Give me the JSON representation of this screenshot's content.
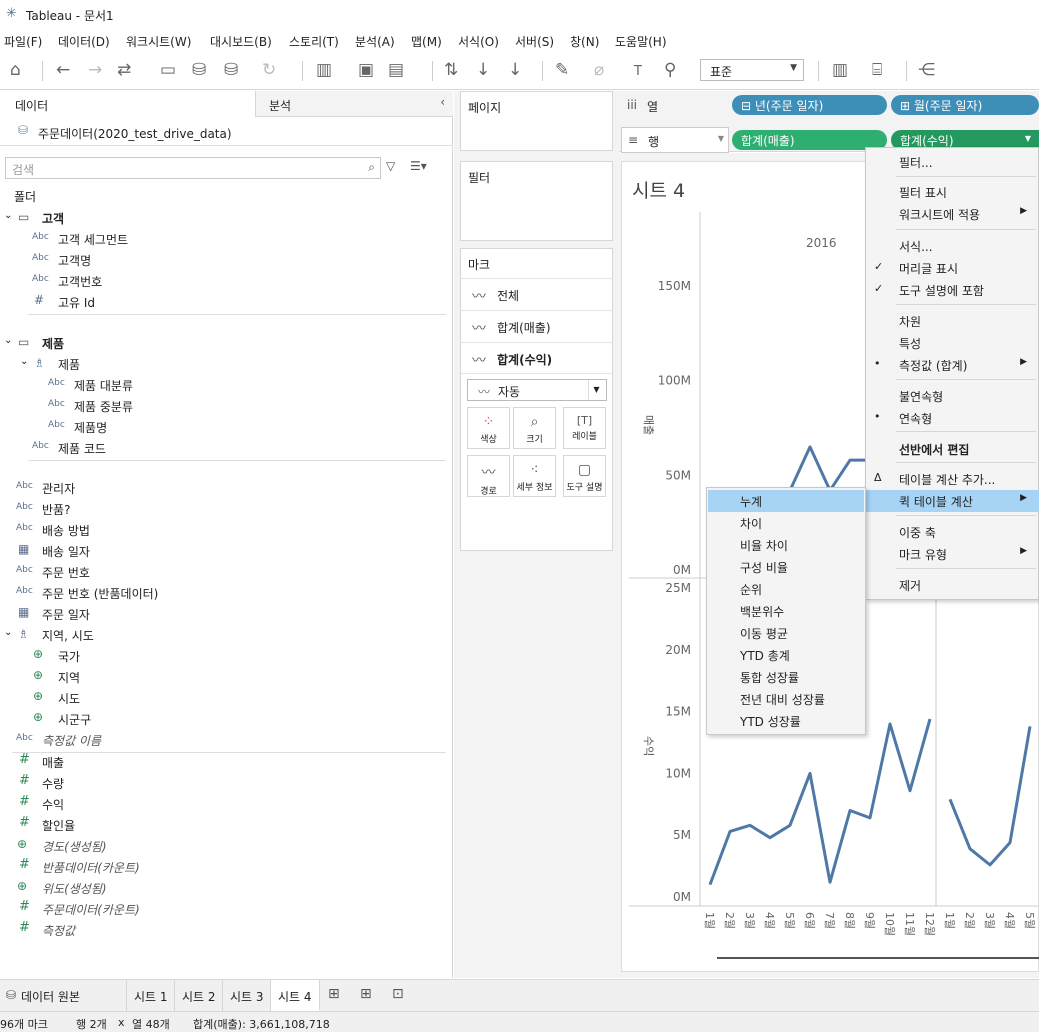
{
  "window": {
    "title": "Tableau - 문서1"
  },
  "menu": [
    "파일(F)",
    "데이터(D)",
    "워크시트(W)",
    "대시보드(B)",
    "스토리(T)",
    "분석(A)",
    "맵(M)",
    "서식(O)",
    "서버(S)",
    "창(N)",
    "도움말(H)"
  ],
  "toolbar": {
    "fit_select": "표준"
  },
  "data_pane": {
    "tab_data": "데이터",
    "tab_analysis": "분석",
    "datasource": "주문데이터(2020_test_drive_data)",
    "search_placeholder": "검색",
    "folder_label": "폴더",
    "groups": {
      "customer": {
        "name": "고객",
        "items": [
          "고객 세그먼트",
          "고객명",
          "고객번호",
          "고유 Id"
        ]
      },
      "product": {
        "name": "제품",
        "hierarchy": "제품",
        "items": [
          "제품 대분류",
          "제품 중분류",
          "제품명"
        ],
        "code": "제품 코드"
      }
    },
    "dimensions": [
      "관리자",
      "반품?",
      "배송 방법",
      "배송 일자",
      "주문 번호",
      "주문 번호 (반품데이터)",
      "주문 일자"
    ],
    "geo": {
      "name": "지역, 시도",
      "items": [
        "국가",
        "지역",
        "시도",
        "시군구"
      ]
    },
    "measure_names": "측정값 이름",
    "measures": [
      "매출",
      "수량",
      "수익",
      "할인율"
    ],
    "generated": [
      "경도(생성됨)",
      "반품데이터(카운트)",
      "위도(생성됨)",
      "주문데이터(카운트)",
      "측정값"
    ]
  },
  "cards": {
    "pages": "페이지",
    "filters": "필터",
    "marks": "마크",
    "marks_rows": [
      "전체",
      "합계(매출)",
      "합계(수익)"
    ],
    "mark_type": "자동",
    "mark_buttons": [
      "색상",
      "크기",
      "레이블",
      "경로",
      "세부 정보",
      "도구 설명"
    ]
  },
  "shelves": {
    "columns_label": "열",
    "rows_label": "행",
    "col_pills": [
      "년(주문 일자)",
      "월(주문 일자)"
    ],
    "row_pills": [
      "합계(매출)",
      "합계(수익)"
    ]
  },
  "sheet": {
    "title": "시트 4",
    "year": "2016",
    "top_axis": {
      "label": "매출",
      "ticks": [
        "150M",
        "100M",
        "50M",
        "0M"
      ]
    },
    "bottom_axis": {
      "label": "수익",
      "ticks": [
        "25M",
        "20M",
        "15M",
        "10M",
        "5M",
        "0M"
      ]
    },
    "month_labels_a": [
      "1월",
      "2월",
      "3월",
      "4월",
      "5월",
      "6월",
      "7월",
      "8월",
      "9월",
      "10월",
      "11월",
      "12월"
    ],
    "month_labels_b": [
      "1월",
      "2월",
      "3월",
      "4월",
      "5월"
    ]
  },
  "chart_data": {
    "type": "line",
    "title": "시트 4",
    "series": [
      {
        "name": "합계(매출)",
        "x": [
          "1월",
          "2월",
          "3월",
          "4월",
          "5월",
          "6월",
          "7월",
          "8월",
          "9월",
          "10월",
          "11월",
          "12월"
        ],
        "values": [
          null,
          null,
          null,
          null,
          42,
          65,
          42,
          58,
          58,
          null,
          null,
          null
        ],
        "ylim": [
          0,
          160
        ]
      },
      {
        "name": "합계(수익)",
        "x": [
          "1월",
          "2월",
          "3월",
          "4월",
          "5월",
          "6월",
          "7월",
          "8월",
          "9월",
          "10월",
          "11월",
          "12월"
        ],
        "values": [
          1.0,
          5.3,
          5.8,
          4.8,
          5.8,
          10.0,
          1.2,
          7.0,
          6.4,
          14.0,
          8.6,
          14.4
        ],
        "ylim": [
          0,
          25
        ]
      },
      {
        "name": "합계(수익)",
        "x": [
          "1월",
          "2월",
          "3월",
          "4월",
          "5월"
        ],
        "values": [
          7.9,
          3.9,
          2.6,
          4.4,
          13.8
        ],
        "ylim": [
          0,
          25
        ]
      }
    ],
    "ylabel": "수익"
  },
  "context_menu": [
    {
      "label": "필터...",
      "check": ""
    },
    {
      "label": "필터 표시",
      "check": ""
    },
    {
      "label": "워크시트에 적용",
      "check": "",
      "sub": true
    },
    {
      "label": "서식...",
      "check": ""
    },
    {
      "label": "머리글 표시",
      "check": "✓"
    },
    {
      "label": "도구 설명에 포함",
      "check": "✓"
    },
    {
      "label": "차원",
      "check": ""
    },
    {
      "label": "특성",
      "check": ""
    },
    {
      "label": "측정값 (합계)",
      "check": "•",
      "sub": true
    },
    {
      "label": "불연속형",
      "check": ""
    },
    {
      "label": "연속형",
      "check": "•"
    },
    {
      "label": "선반에서 편집",
      "check": ""
    },
    {
      "label": "테이블 계산 추가...",
      "check": "Δ"
    },
    {
      "label": "퀵 테이블 계산",
      "check": "",
      "sub": true
    },
    {
      "label": "이중 축",
      "check": ""
    },
    {
      "label": "마크 유형",
      "check": "",
      "sub": true
    },
    {
      "label": "제거",
      "check": ""
    }
  ],
  "submenu": [
    "누계",
    "차이",
    "비율 차이",
    "구성 비율",
    "순위",
    "백분위수",
    "이동 평균",
    "YTD 총계",
    "통합 성장률",
    "전년 대비 성장률",
    "YTD 성장률"
  ],
  "bottom_tabs": [
    "데이터 원본",
    "시트 1",
    "시트 2",
    "시트 3",
    "시트 4"
  ],
  "status": {
    "marks": "96개 마크",
    "rows": "행 2개",
    "x": "x",
    "cols": "열 48개",
    "sum": "합계(매출): 3,661,108,718"
  }
}
